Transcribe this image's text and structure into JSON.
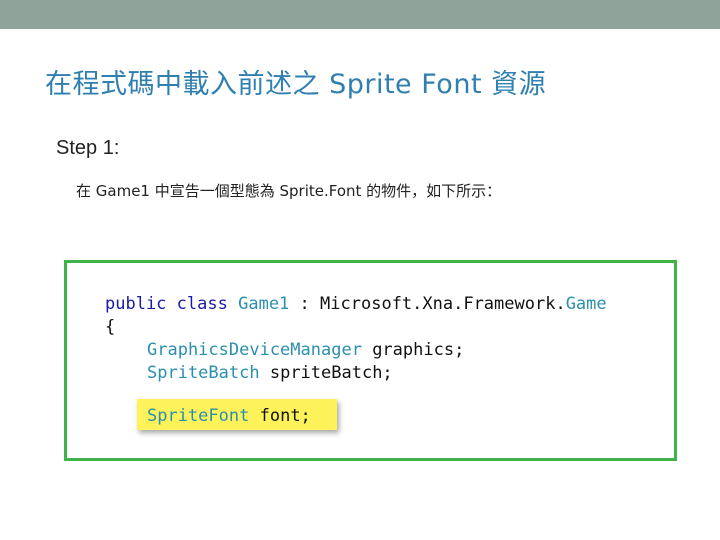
{
  "slide": {
    "title": "在程式碼中載入前述之 Sprite Font 資源",
    "step_label": "Step 1:",
    "step_description": "在 Game1 中宣告一個型態為 Sprite.Font 的物件，如下所示："
  },
  "code": {
    "line1": {
      "kw1": "public",
      "kw2": "class",
      "class_name": "Game1",
      "colon": ":",
      "ns": "Microsoft.Xna.Framework.",
      "base": "Game"
    },
    "line2": "{",
    "line3": {
      "type": "GraphicsDeviceManager",
      "ident": "graphics;"
    },
    "line4": {
      "type": "SpriteBatch",
      "ident": "spriteBatch;"
    },
    "line5": {
      "type": "SpriteFont",
      "ident": "font;"
    }
  },
  "colors": {
    "top_bar": "#8fa39a",
    "title": "#2f7fb0",
    "frame_border": "#3cb44a",
    "keyword": "#1a1aa6",
    "type": "#2b8fae",
    "highlight": "#fdf25a"
  }
}
